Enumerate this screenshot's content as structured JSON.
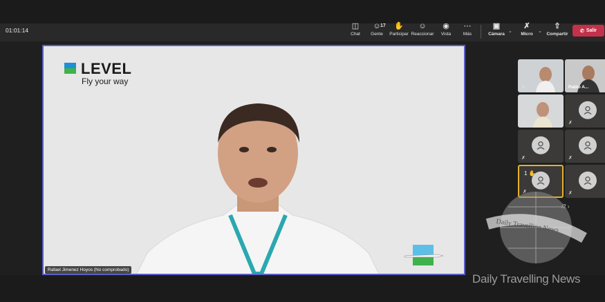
{
  "meeting": {
    "timer": "01:01:14"
  },
  "toolbar": {
    "chat_label": "Chat",
    "people_label": "Gente",
    "people_count": "17",
    "participate_label": "Participar",
    "react_label": "Reaccionar",
    "view_label": "Vista",
    "more_label": "Más",
    "camera_label": "Cámara",
    "mic_label": "Micro",
    "share_label": "Compartir",
    "leave_label": "Salir"
  },
  "main_video": {
    "logo_text": "LEVEL",
    "logo_tagline": "Fly your way",
    "speaker_name": "Rafael Jimenez Hoyos (No comprobado)"
  },
  "participants": [
    {
      "name": ""
    },
    {
      "name": "Pablo A..."
    },
    {
      "name": ""
    },
    {
      "name": ""
    },
    {
      "name": ""
    },
    {
      "name": ""
    },
    {
      "name": "",
      "raised_hand_order": "1"
    },
    {
      "name": ""
    }
  ],
  "pager": {
    "text": "/2"
  },
  "watermark": {
    "text": "Daily Travelling News",
    "banner_text": "Daily Travelling News"
  },
  "colors": {
    "accent": "#5b5fc7",
    "leave": "#c4314b",
    "active_speaker": "#e6b12b"
  }
}
